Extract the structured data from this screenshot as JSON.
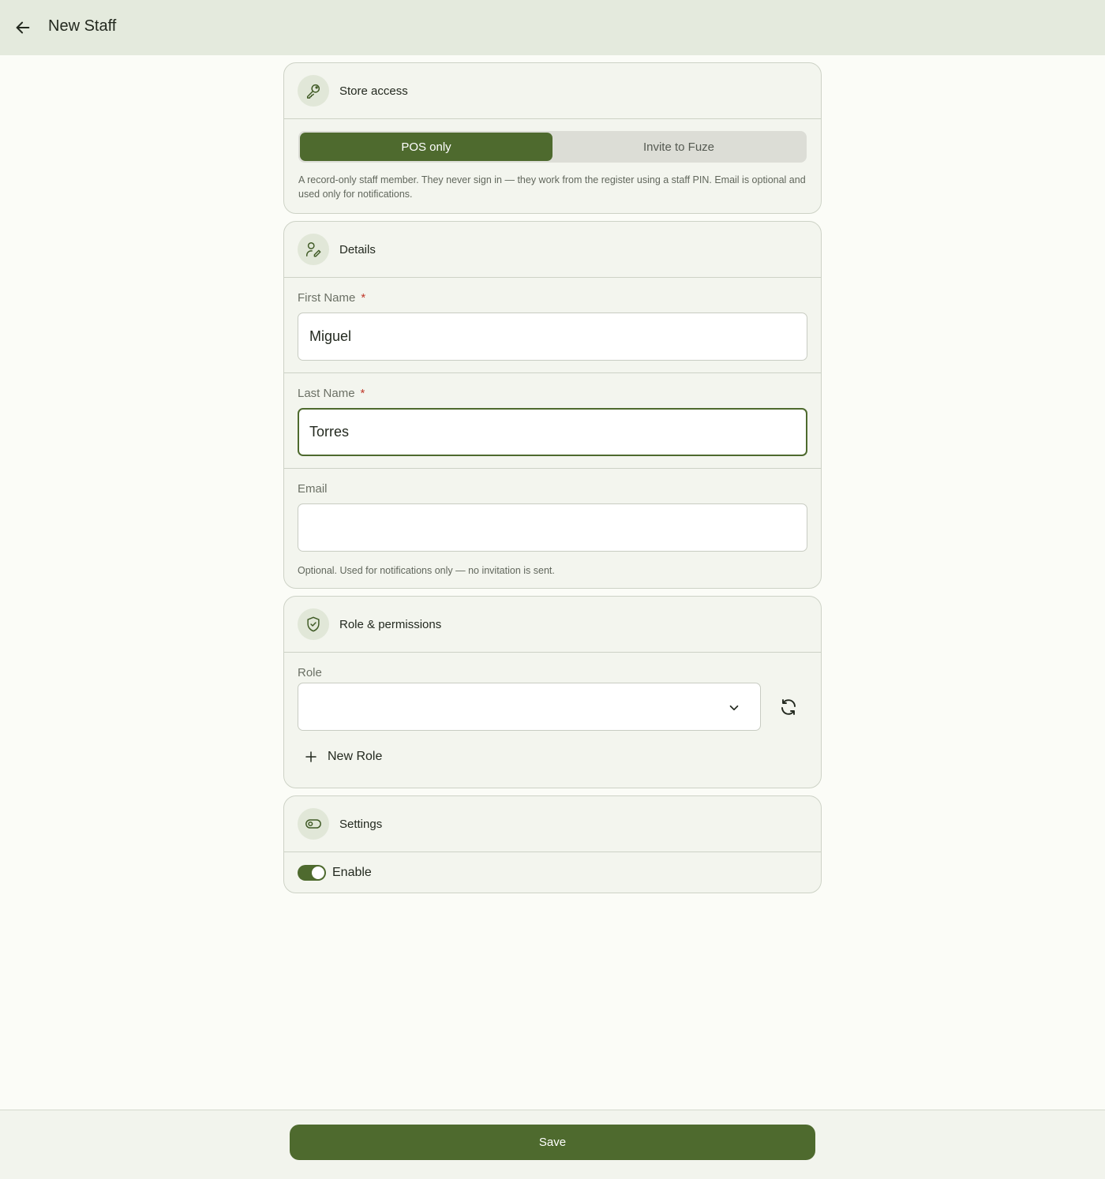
{
  "header": {
    "title": "New Staff",
    "back_icon": "arrow-left-icon"
  },
  "store_access": {
    "title": "Store access",
    "icon": "key-icon",
    "options": [
      {
        "label": "POS only",
        "selected": true
      },
      {
        "label": "Invite to Fuze",
        "selected": false
      }
    ],
    "description": "A record-only staff member. They never sign in — they work from the register using a staff PIN. Email is optional and used only for notifications."
  },
  "details": {
    "title": "Details",
    "icon": "user-edit-icon",
    "first_name": {
      "label": "First Name",
      "required_mark": "*",
      "value": "Miguel"
    },
    "last_name": {
      "label": "Last Name",
      "required_mark": "*",
      "value": "Torres"
    },
    "email": {
      "label": "Email",
      "value": "",
      "help": "Optional. Used for notifications only — no invitation is sent."
    }
  },
  "role_permissions": {
    "title": "Role & permissions",
    "icon": "shield-check-icon",
    "role": {
      "label": "Role",
      "value": ""
    },
    "new_role_label": "New Role"
  },
  "settings": {
    "title": "Settings",
    "icon": "toggle-icon",
    "enable": {
      "label": "Enable",
      "on": true
    }
  },
  "footer": {
    "save_label": "Save"
  },
  "colors": {
    "accent": "#4e6a2e",
    "topbar": "#e4eadd",
    "card": "#f3f5ee",
    "required": "#c0392b"
  }
}
